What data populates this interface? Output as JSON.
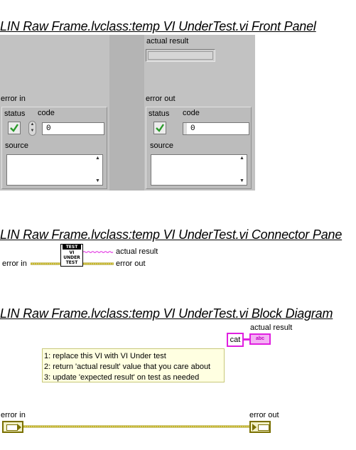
{
  "sections": {
    "front_panel_title": "LIN Raw Frame.lvclass:temp  VI  UnderTest.vi Front Panel",
    "connector_pane_title": "LIN Raw Frame.lvclass:temp  VI  UnderTest.vi Connector Pane",
    "block_diagram_title": "LIN Raw Frame.lvclass:temp  VI  UnderTest.vi Block Diagram"
  },
  "front_panel": {
    "actual_result_label": "actual result",
    "error_in": {
      "label": "error in",
      "status_label": "status",
      "code_label": "code",
      "code_value": "0",
      "source_label": "source"
    },
    "error_out": {
      "label": "error out",
      "status_label": "status",
      "code_label": "code",
      "code_value": "0",
      "source_label": "source"
    }
  },
  "connector_pane": {
    "icon_lines": [
      "TEST",
      "VI",
      "UNDER",
      "TEST"
    ],
    "actual_result_label": "actual result",
    "error_in_label": "error in",
    "error_out_label": "error out"
  },
  "block_diagram": {
    "actual_result_label": "actual result",
    "string_constant": "cat",
    "indicator_glyph": "abc",
    "comment_lines": [
      "1: replace this VI with VI Under test",
      "2: return 'actual result' value that you care about",
      "3: update 'expected result' on test as needed"
    ],
    "error_in_label": "error in",
    "error_out_label": "error out"
  },
  "colors": {
    "panel_bg": "#c2c2c2",
    "string_wire": "#e020e0",
    "error_wire": "#a09000",
    "comment_bg": "#ffffe1",
    "check_green": "#2a9a2a"
  }
}
